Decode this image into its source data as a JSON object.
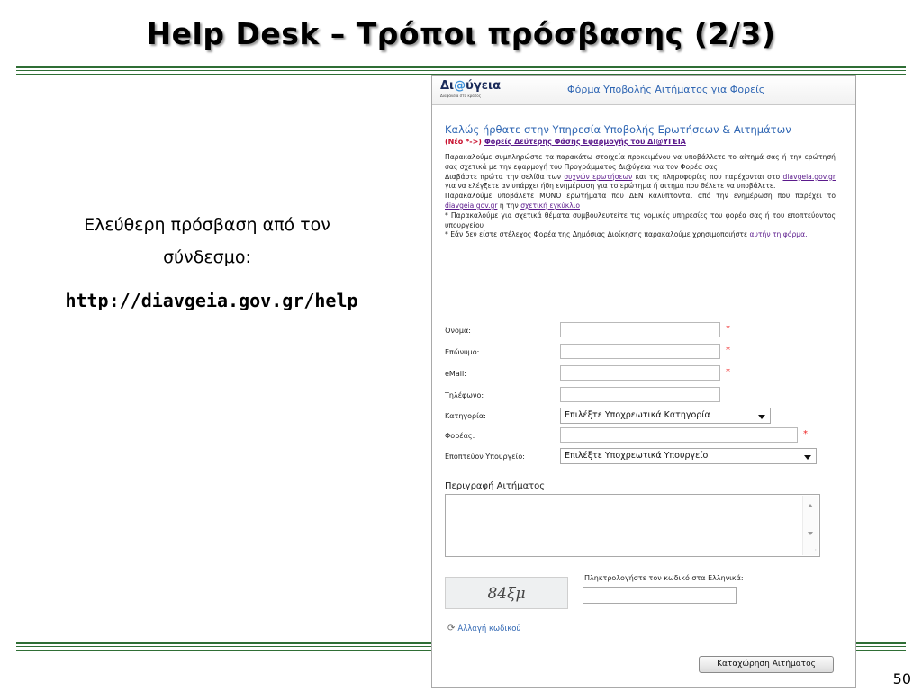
{
  "slide": {
    "title": "Help Desk – Τρόποι πρόσβασης (2/3)",
    "left_line1": "Ελεύθερη πρόσβαση από τον",
    "left_line2": "σύνδεσμο:",
    "link": "http://diavgeia.gov.gr/help",
    "page_number": "50"
  },
  "form": {
    "logo": {
      "prefix": "Δι",
      "at": "@",
      "suffix": "ύγεια",
      "tagline": "Διαφάνεια στο κράτος"
    },
    "header_title": "Φόρμα Υποβολής Αιτήματος για Φορείς",
    "welcome": "Καλώς ήρθατε στην Υπηρεσία Υποβολής Ερωτήσεων & Αιτημάτων",
    "new_prefix": "(Νέο *->)",
    "new_link": "Φορείς Δεύτερης Φάσης Εφαρμογής του ΔΙ@ΥΓΕΙΑ",
    "intro": {
      "p1": "Παρακαλούμε συμπληρώστε τα παρακάτω στοιχεία προκειμένου να υποβάλλετε το αίτημά σας ή την ερώτησή σας σχετικά με την εφαρμογή του Προγράμματος Δι@ύγεια για τον Φορέα σας",
      "p2a": "Διαβάστε πρώτα την σελίδα των",
      "p2_link": "συχνών ερωτήσεων",
      "p2b": "και τις πληροφορίες που παρέχονται στο",
      "p2_link2": "diavgeia.gov.gr",
      "p2c": "για να ελέγξετε αν υπάρχει ήδη ενημέρωση για το ερώτημα ή αιτημα που θέλετε να υποβάλετε.",
      "p3a": "Παρακαλούμε υποβάλετε ΜΟΝΟ ερωτήματα που ΔΕΝ καλύπτονται από την ενημέρωση που παρέχει το",
      "p3_link": "diavgeia.gov.gr",
      "p3b": "ή την",
      "p3_link2": "σχετική εγκύκλιο",
      "p4": "* Παρακαλούμε για σχετικά θέματα συμβουλευτείτε τις νομικές υπηρεσίες του φορέα σας ή του εποπτεύοντος υπουργείου",
      "p5a": "* Εάν δεν είστε στέλεχος Φορέα της Δημόσιας Διοίκησης παρακαλούμε χρησιμοποιήστε",
      "p5_link": "αυτήν τη φόρμα."
    },
    "fields": {
      "first_name": "Όνομα:",
      "last_name": "Επώνυμο:",
      "email": "eMail:",
      "phone": "Τηλέφωνο:",
      "category": "Κατηγορία:",
      "organization": "Φορέας:",
      "ministry": "Εποπτεύον Υπουργείο:",
      "required_mark": "*"
    },
    "category_select": "Επιλέξτε Υποχρεωτικά Κατηγορία",
    "ministry_select": "Επιλέξτε Υποχρεωτικά Υπουργείο",
    "description_label": "Περιγραφή Αιτήματος",
    "captcha_text": "84ξμ",
    "captcha_label": "Πληκτρολογήστε τον κωδικό στα Ελληνικά:",
    "change_code": "Αλλαγή κωδικού",
    "submit": "Καταχώρηση Αιτήματος"
  }
}
